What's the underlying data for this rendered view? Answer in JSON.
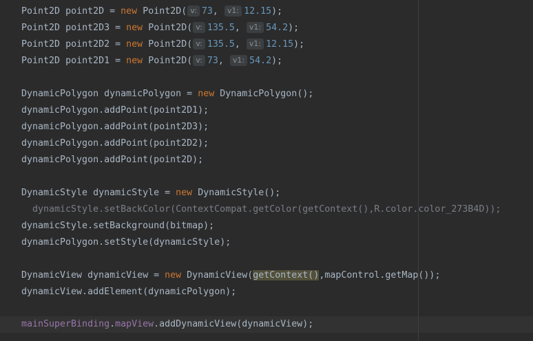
{
  "lines": [
    {
      "type": "Point2D",
      "var": "point2D",
      "kw": "new",
      "ctor": "Point2D(",
      "h1": "v:",
      "x": "73",
      "h2": "v1:",
      "y": "12.15",
      "end": ");"
    },
    {
      "type": "Point2D",
      "var": "point2D3",
      "kw": "new",
      "ctor": "Point2D(",
      "h1": "v:",
      "x": "135.5",
      "h2": "v1:",
      "y": "54.2",
      "end": ");"
    },
    {
      "type": "Point2D",
      "var": "point2D2",
      "kw": "new",
      "ctor": "Point2D(",
      "h1": "v:",
      "x": "135.5",
      "h2": "v1:",
      "y": "12.15",
      "end": ");"
    },
    {
      "type": "Point2D",
      "var": "point2D1",
      "kw": "new",
      "ctor": "Point2D(",
      "h1": "v:",
      "x": "73",
      "h2": "v1:",
      "y": "54.2",
      "end": ");"
    }
  ],
  "poly": {
    "decl_a": "DynamicPolygon dynamicPolygon = ",
    "kw": "new",
    "decl_b": " DynamicPolygon",
    "decl_c": "();",
    "add1": "dynamicPolygon.addPoint(point2D1);",
    "add2": "dynamicPolygon.addPoint(point2D3);",
    "add3": "dynamicPolygon.addPoint(point2D2);",
    "add4": "dynamicPolygon.addPoint(point2D);"
  },
  "style": {
    "decl_a": "DynamicStyle dynamicStyle = ",
    "kw": "new",
    "decl_b": " DynamicStyle",
    "decl_c": "();",
    "back": "dynamicStyle.setBackColor(ContextCompat.getColor(getContext(),R.color.color_273B4D));",
    "bg": "dynamicStyle.setBackground(bitmap);",
    "setstyle": "dynamicPolygon.setStyle(dynamicStyle);"
  },
  "view": {
    "decl_a": "DynamicView dynamicView = ",
    "kw": "new",
    "decl_b": " DynamicView(",
    "ctx": "getContext()",
    "decl_c": ",mapControl.getMap());",
    "add": "dynamicView.addElement(dynamicPolygon);"
  },
  "binding": {
    "obj": "mainSuperBinding",
    "dot1": ".",
    "field": "mapView",
    "rest": ".addDynamicView(dynamicView);"
  }
}
